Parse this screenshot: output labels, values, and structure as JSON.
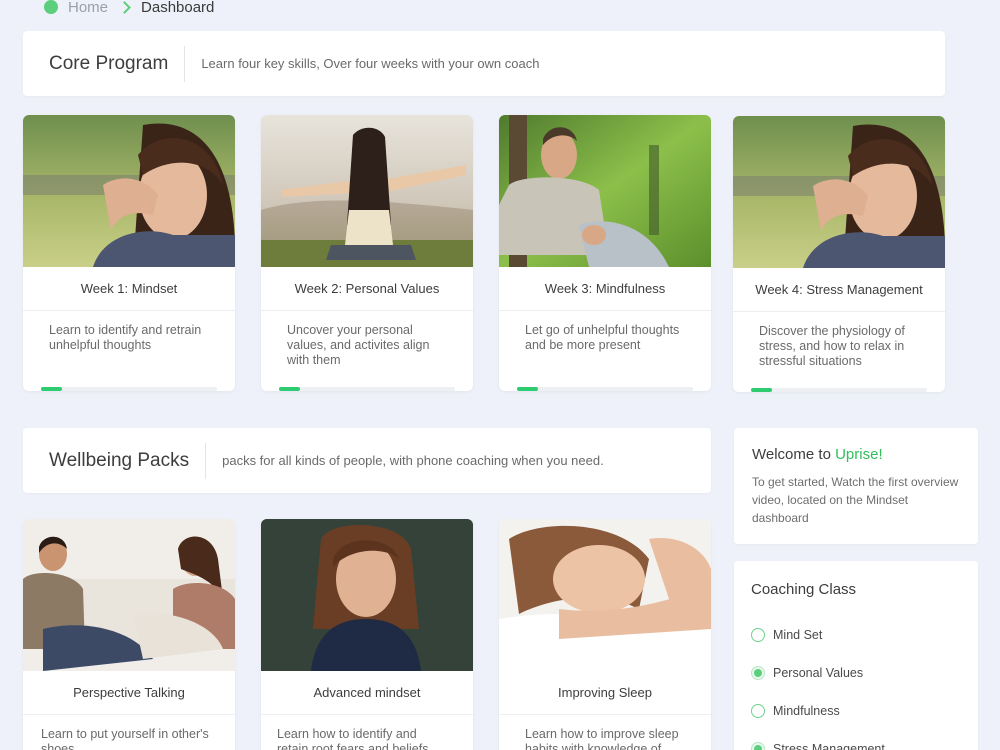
{
  "breadcrumb": {
    "home": "Home",
    "current": "Dashboard"
  },
  "core_program": {
    "title": "Core Program",
    "description": "Learn four key skills, Over four weeks with your own coach",
    "weeks": [
      {
        "title": "Week 1: Mindset",
        "description": "Learn to identify and retrain unhelpful thoughts",
        "progress": 0.12,
        "image": "woman-thinking-photo"
      },
      {
        "title": "Week 2: Personal Values",
        "description": "Uncover your personal values, and activites align with them",
        "progress": 0.12,
        "image": "woman-arms-open-photo"
      },
      {
        "title": "Week 3: Mindfulness",
        "description": "Let go of unhelpful thoughts and be more present",
        "progress": 0.12,
        "image": "man-relaxing-photo"
      },
      {
        "title": "Week 4: Stress Management",
        "description": "Discover the physiology of stress, and how to relax in stressful situations",
        "progress": 0.12,
        "image": "woman-thinking-photo"
      }
    ]
  },
  "wellbeing_packs": {
    "title": "Wellbeing Packs",
    "description": "packs for all kinds of people, with phone coaching when you need.",
    "packs": [
      {
        "title": "Perspective Talking",
        "description": "Learn to put yourself in other's shoes",
        "image": "couple-talking-photo"
      },
      {
        "title": "Advanced mindset",
        "description": "Learn how to identify and retain root fears and beliefs",
        "image": "girl-thinking-photo"
      },
      {
        "title": "Improving Sleep",
        "description": "Learn how to improve sleep habits with knowledge of",
        "image": "woman-sleeping-photo"
      }
    ]
  },
  "welcome": {
    "title_prefix": "Welcome to ",
    "brand": "Uprise!",
    "text": "To get started, Watch the first overview video, located on the  Mindset dashboard"
  },
  "coaching_class": {
    "title": "Coaching Class",
    "items": [
      {
        "label": "Mind Set",
        "checked": false
      },
      {
        "label": "Personal Values",
        "checked": true
      },
      {
        "label": "Mindfulness",
        "checked": false
      },
      {
        "label": "Stress Management",
        "checked": true
      }
    ]
  },
  "colors": {
    "accent": "#2ecc71",
    "brand": "#2fbf5b",
    "background": "#eef1f9"
  }
}
